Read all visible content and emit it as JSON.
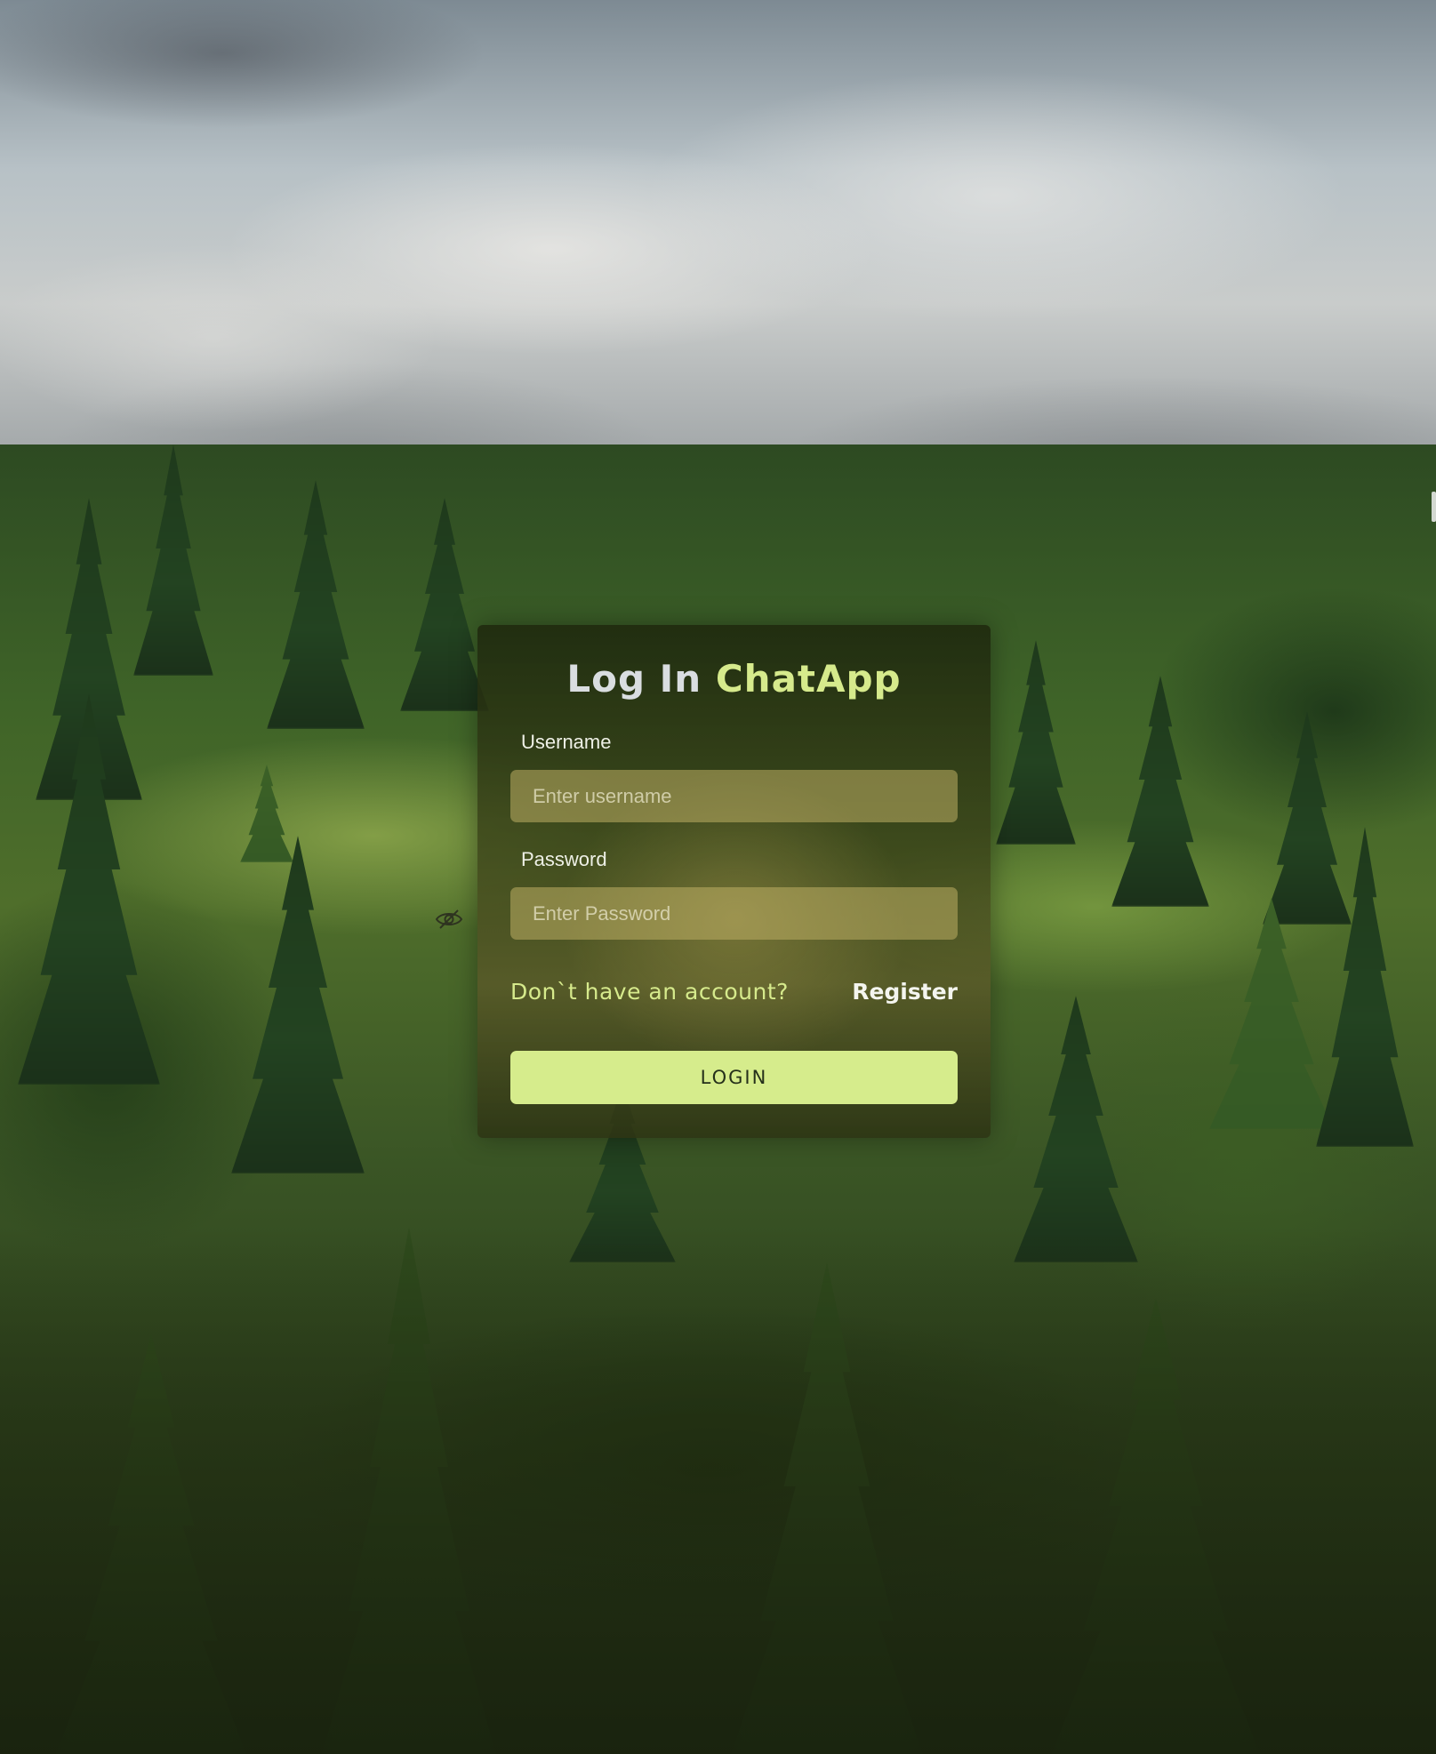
{
  "login": {
    "title_part1": "Log In",
    "title_part2": "ChatApp",
    "username_label": "Username",
    "username_placeholder": "Enter username",
    "username_value": "",
    "password_label": "Password",
    "password_placeholder": "Enter Password",
    "password_value": "",
    "password_toggle_icon": "eye-off-icon",
    "signup_question": "Don`t have an account?",
    "register_label": "Register",
    "login_button_label": "LOGIN"
  },
  "colors": {
    "accent": "#d6ea8c",
    "button": "#d6ec8c",
    "title_text": "#d9dde0"
  }
}
